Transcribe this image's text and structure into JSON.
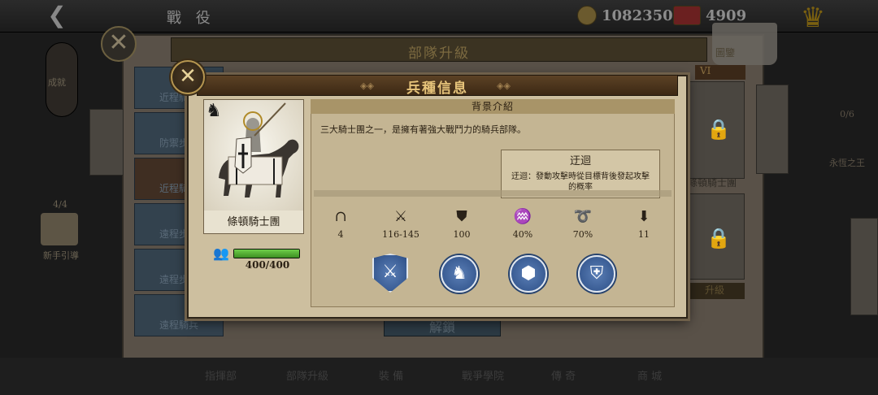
{
  "top": {
    "back_icon": "arrow-left-icon",
    "title": "戰 役",
    "gold": "1082350",
    "gems": "4909"
  },
  "background": {
    "header_title": "部隊升級",
    "book_label": "圖鑒",
    "roman": "VI",
    "achievement_label": "成就",
    "stat_left": "4/4",
    "stat_left_label": "新手引導",
    "tabs": [
      "近程騎兵",
      "防禦步兵",
      "近程騎兵",
      "遠程步兵",
      "遠程步兵",
      "遠程騎兵"
    ],
    "card_label_1": "條頓騎士團",
    "card_label_2": "升級",
    "right_stat": "0/6",
    "right_stat_label": "永恆之王",
    "unlock_label": "解鎖",
    "bottom_items": [
      "指揮部",
      "部隊升級",
      "裝 備",
      "戰爭學院",
      "傳 奇",
      "商 城"
    ]
  },
  "modal": {
    "title": "兵種信息",
    "close_icon": "close-icon",
    "unit_name": "條頓騎士團",
    "unit_type_icon": "horse-knight-icon",
    "troop_icon": "troops-icon",
    "troops": "400/400",
    "troops_fill": 1.0,
    "intro_header": "背景介紹",
    "description": "三大騎士團之一，是擁有著強大戰鬥力的騎兵部隊。",
    "skill": {
      "title": "迂迴",
      "desc": "迂迴：發動攻擊時從目標背後發起攻擊的概率"
    },
    "stats": [
      {
        "icon": "helmet-icon",
        "value": "4"
      },
      {
        "icon": "crossed-swords-icon",
        "value": "116-145"
      },
      {
        "icon": "shield-icon",
        "value": "100"
      },
      {
        "icon": "claw-icon",
        "value": "40%"
      },
      {
        "icon": "swirl-icon",
        "value": "70%"
      },
      {
        "icon": "boot-icon",
        "value": "11"
      }
    ],
    "abilities": [
      "lance-shield-ability-icon",
      "horse-charge-ability-icon",
      "horse-hoof-ability-icon",
      "armor-ability-icon"
    ]
  }
}
